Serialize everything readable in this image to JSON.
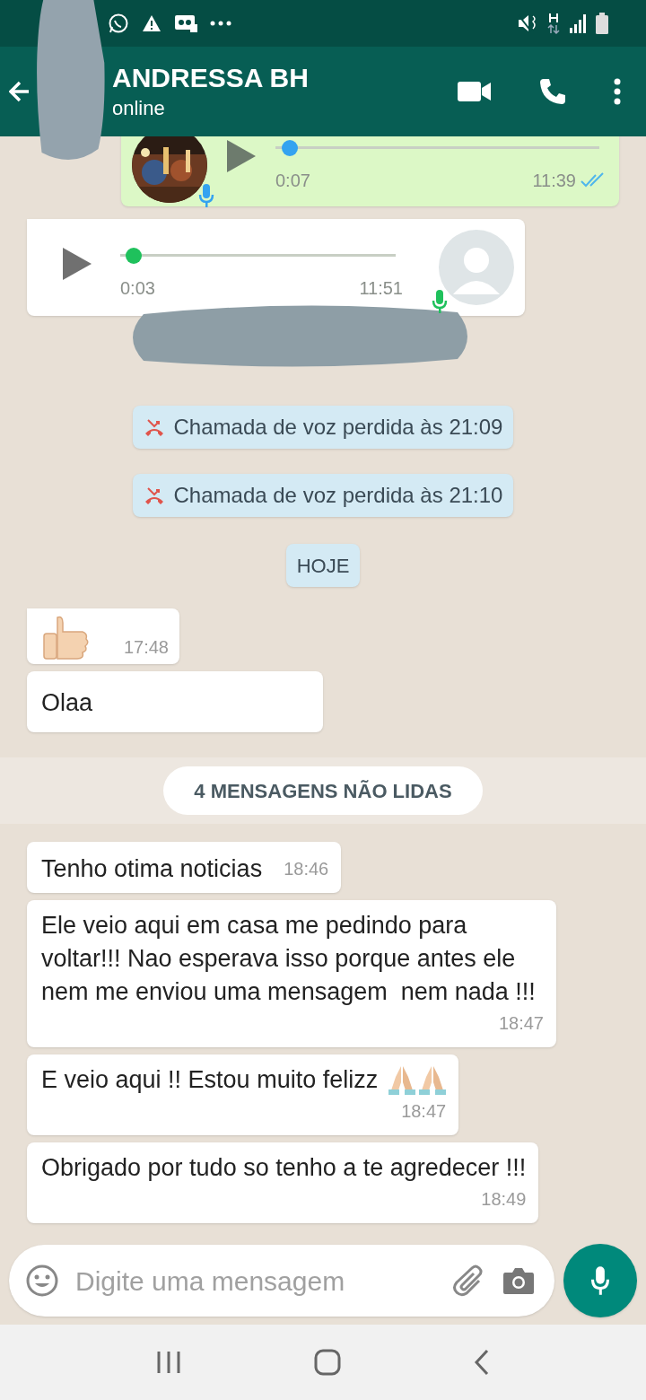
{
  "header": {
    "name": "ANDRESSA BH",
    "status": "online"
  },
  "messages": [
    {
      "kind": "outgoing-voice",
      "duration": "0:07",
      "time": "11:39",
      "level": 0.02,
      "read": true
    },
    {
      "kind": "incoming-voice",
      "duration": "0:03",
      "time": "11:51",
      "level": 0.02
    },
    {
      "kind": "redacted"
    },
    {
      "kind": "system",
      "text": "Chamada de voz perdida às 21:09"
    },
    {
      "kind": "system",
      "text": "Chamada de voz perdida às 21:10"
    },
    {
      "kind": "date",
      "text": "HOJE"
    },
    {
      "kind": "thumbs-up",
      "time": "17:48"
    },
    {
      "kind": "text",
      "text": "Olaa"
    },
    {
      "kind": "unread",
      "text": "4 MENSAGENS NÃO LIDAS"
    },
    {
      "kind": "short-text",
      "text": "Tenho otima noticias",
      "time": "18:46"
    },
    {
      "kind": "text",
      "text": "Ele veio aqui em casa me pedindo para voltar!!! Nao esperava isso porque antes ele nem me enviou uma mensagem  nem nada !!!",
      "time": "18:47"
    },
    {
      "kind": "text-praying",
      "text": "E veio aqui !! Estou muito felizz",
      "time": "18:47"
    },
    {
      "kind": "text",
      "text": "Obrigado por tudo so tenho a te agredecer !!!",
      "time": "18:49"
    }
  ],
  "composer": {
    "placeholder": "Digite uma mensagem"
  }
}
